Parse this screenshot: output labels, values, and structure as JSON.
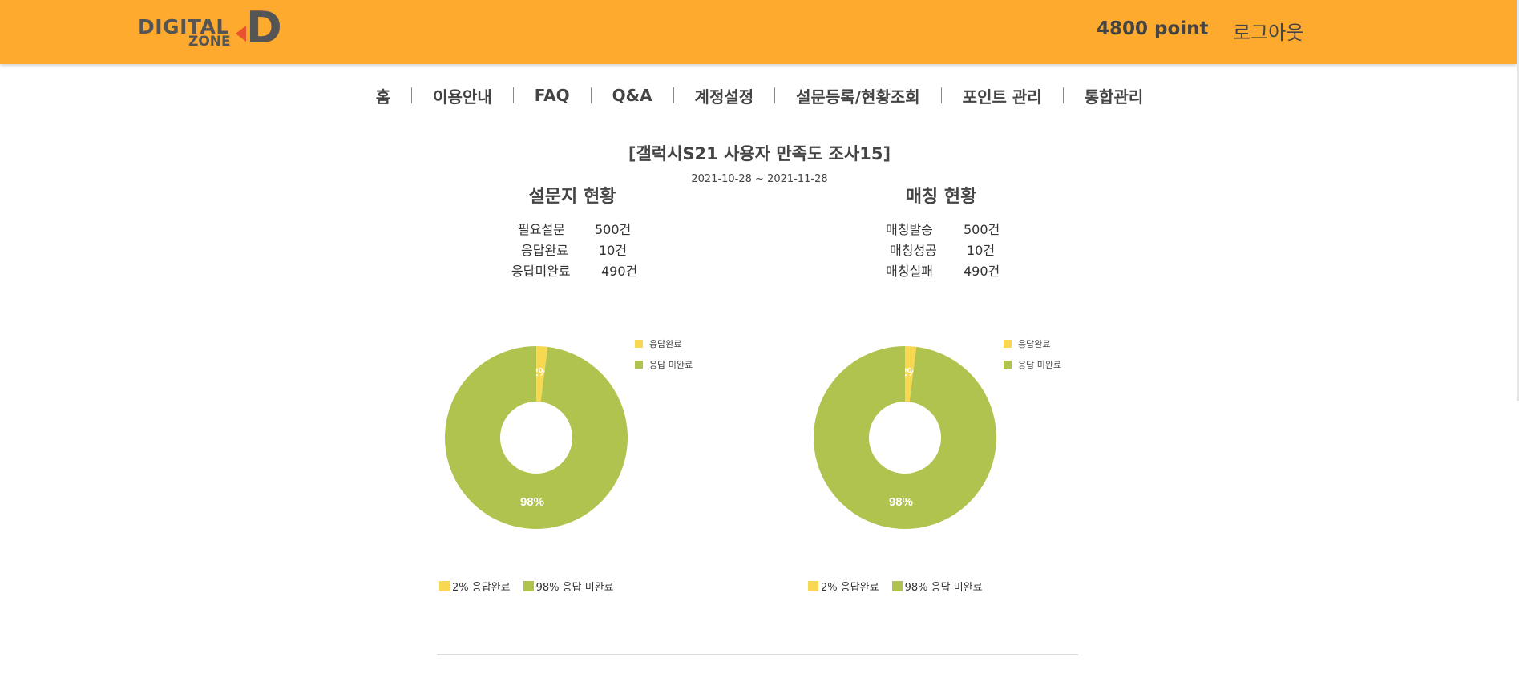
{
  "header": {
    "logo": {
      "line1": "DIGITAL",
      "line2": "ZONE",
      "letter": "D"
    },
    "points": "4800 point",
    "logout": "로그아웃"
  },
  "nav": [
    "홈",
    "이용안내",
    "FAQ",
    "Q&A",
    "계정설정",
    "설문등록/현황조회",
    "포인트 관리",
    "통합관리"
  ],
  "survey": {
    "title": "[갤럭시S21 사용자 만족도 조사15]",
    "dates": "2021-10-28 ~ 2021-11-28"
  },
  "survey_status": {
    "heading": "설문지 현황",
    "rows": [
      {
        "label": "필요설문",
        "value": "500건"
      },
      {
        "label": "응답완료",
        "value": "10건"
      },
      {
        "label": "응답미완료",
        "value": "490건"
      }
    ]
  },
  "matching_status": {
    "heading": "매칭 현황",
    "rows": [
      {
        "label": "매칭발송",
        "value": "500건"
      },
      {
        "label": "매칭성공",
        "value": "10건"
      },
      {
        "label": "매칭실패",
        "value": "490건"
      }
    ]
  },
  "colors": {
    "header": "#fdaa2f",
    "completed": "#f8d851",
    "incomplete": "#b0c34e"
  },
  "chart_data": [
    {
      "type": "pie",
      "categories": [
        "응답완료",
        "응답 미완료"
      ],
      "values": [
        2,
        98
      ],
      "data_labels": [
        "2%",
        "98%"
      ],
      "legend_top": [
        "응답완료",
        "응답 미완료"
      ],
      "legend_bottom": [
        "2% 응답완료",
        "98% 응답 미완료"
      ],
      "colors": [
        "#f8d851",
        "#b0c34e"
      ]
    },
    {
      "type": "pie",
      "categories": [
        "응답완료",
        "응답 미완료"
      ],
      "values": [
        2,
        98
      ],
      "data_labels": [
        "2%",
        "98%"
      ],
      "legend_top": [
        "응답완료",
        "응답 미완료"
      ],
      "legend_bottom": [
        "2% 응답완료",
        "98% 응답 미완료"
      ],
      "colors": [
        "#f8d851",
        "#b0c34e"
      ]
    }
  ]
}
